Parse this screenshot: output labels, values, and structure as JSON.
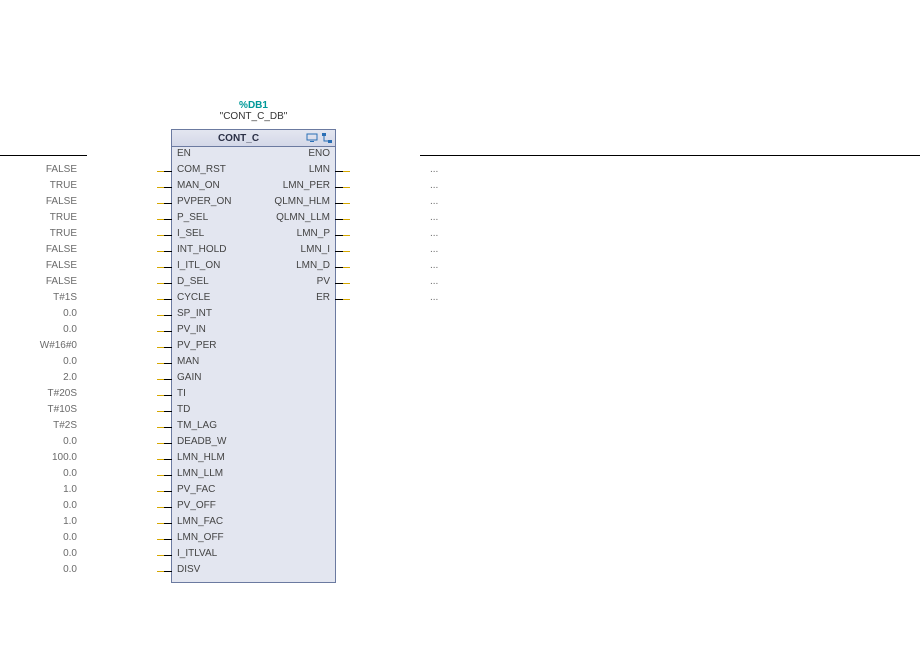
{
  "block": {
    "address": "%DB1",
    "instance_name": "\"CONT_C_DB\"",
    "type_name": "CONT_C",
    "icons": {
      "monitor": "monitor-icon",
      "structure": "structure-icon"
    }
  },
  "inputs": [
    {
      "name": "EN",
      "value": "",
      "rail": true
    },
    {
      "name": "COM_RST",
      "value": "FALSE"
    },
    {
      "name": "MAN_ON",
      "value": "TRUE"
    },
    {
      "name": "PVPER_ON",
      "value": "FALSE"
    },
    {
      "name": "P_SEL",
      "value": "TRUE"
    },
    {
      "name": "I_SEL",
      "value": "TRUE"
    },
    {
      "name": "INT_HOLD",
      "value": "FALSE"
    },
    {
      "name": "I_ITL_ON",
      "value": "FALSE"
    },
    {
      "name": "D_SEL",
      "value": "FALSE"
    },
    {
      "name": "CYCLE",
      "value": "T#1S"
    },
    {
      "name": "SP_INT",
      "value": "0.0"
    },
    {
      "name": "PV_IN",
      "value": "0.0"
    },
    {
      "name": "PV_PER",
      "value": "W#16#0"
    },
    {
      "name": "MAN",
      "value": "0.0"
    },
    {
      "name": "GAIN",
      "value": "2.0"
    },
    {
      "name": "TI",
      "value": "T#20S"
    },
    {
      "name": "TD",
      "value": "T#10S"
    },
    {
      "name": "TM_LAG",
      "value": "T#2S"
    },
    {
      "name": "DEADB_W",
      "value": "0.0"
    },
    {
      "name": "LMN_HLM",
      "value": "100.0"
    },
    {
      "name": "LMN_LLM",
      "value": "0.0"
    },
    {
      "name": "PV_FAC",
      "value": "1.0"
    },
    {
      "name": "PV_OFF",
      "value": "0.0"
    },
    {
      "name": "LMN_FAC",
      "value": "1.0"
    },
    {
      "name": "LMN_OFF",
      "value": "0.0"
    },
    {
      "name": "I_ITLVAL",
      "value": "0.0"
    },
    {
      "name": "DISV",
      "value": "0.0"
    }
  ],
  "outputs": [
    {
      "name": "ENO",
      "value": "",
      "rail": true
    },
    {
      "name": "LMN",
      "value": "..."
    },
    {
      "name": "LMN_PER",
      "value": "..."
    },
    {
      "name": "QLMN_HLM",
      "value": "..."
    },
    {
      "name": "QLMN_LLM",
      "value": "..."
    },
    {
      "name": "LMN_P",
      "value": "..."
    },
    {
      "name": "LMN_I",
      "value": "..."
    },
    {
      "name": "LMN_D",
      "value": "..."
    },
    {
      "name": "PV",
      "value": "..."
    },
    {
      "name": "ER",
      "value": "..."
    }
  ]
}
